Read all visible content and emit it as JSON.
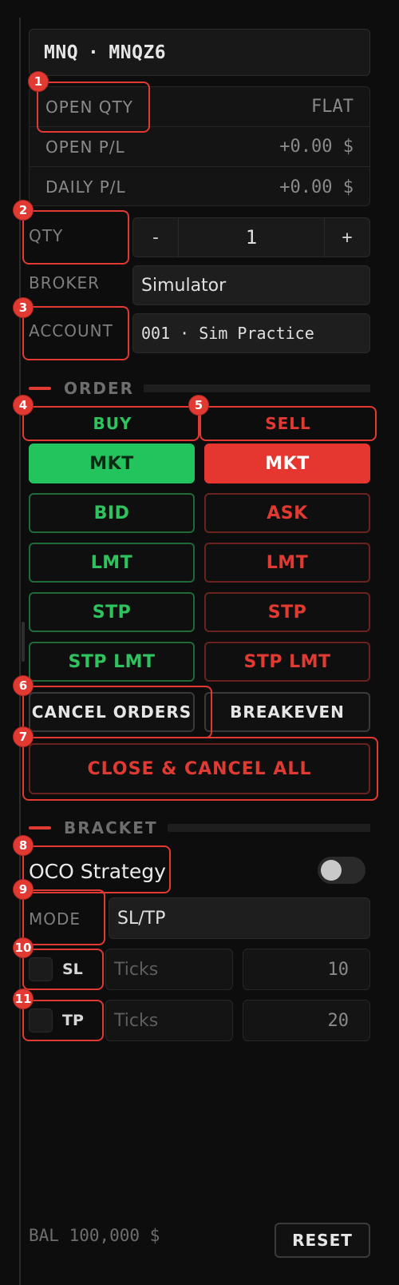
{
  "symbol": {
    "root": "MNQ",
    "separator": "·",
    "contract": "MNQZ6"
  },
  "stats": [
    {
      "label": "OPEN QTY",
      "value": "FLAT"
    },
    {
      "label": "OPEN P/L",
      "value": "+0.00 $"
    },
    {
      "label": "DAILY P/L",
      "value": "+0.00 $"
    }
  ],
  "qty": {
    "label": "QTY",
    "minus": "-",
    "value": "1",
    "plus": "+"
  },
  "broker": {
    "label": "BROKER",
    "value": "Simulator"
  },
  "account": {
    "label": "ACCOUNT",
    "value": "001 · Sim Practice"
  },
  "order": {
    "title": "ORDER",
    "buy_label": "BUY",
    "sell_label": "SELL",
    "buy_buttons": [
      "MKT",
      "BID",
      "LMT",
      "STP",
      "STP LMT"
    ],
    "sell_buttons": [
      "MKT",
      "ASK",
      "LMT",
      "STP",
      "STP LMT"
    ],
    "cancel_orders": "CANCEL ORDERS",
    "breakeven": "BREAKEVEN",
    "close_cancel_all": "CLOSE & CANCEL ALL"
  },
  "bracket": {
    "title": "BRACKET",
    "oco_label": "OCO Strategy",
    "oco_enabled": false,
    "mode_label": "MODE",
    "mode_value": "SL/TP",
    "sl": {
      "label": "SL",
      "unit": "Ticks",
      "value": "10"
    },
    "tp": {
      "label": "TP",
      "unit": "Ticks",
      "value": "20"
    }
  },
  "footer": {
    "balance": "BAL 100,000 $",
    "reset": "RESET"
  },
  "annotations": [
    "1",
    "2",
    "3",
    "4",
    "5",
    "6",
    "7",
    "8",
    "9",
    "10",
    "11"
  ],
  "colors": {
    "buy": "#23c35e",
    "sell": "#e5372f",
    "accent": "#e03a33",
    "background": "#0d0d0d"
  }
}
